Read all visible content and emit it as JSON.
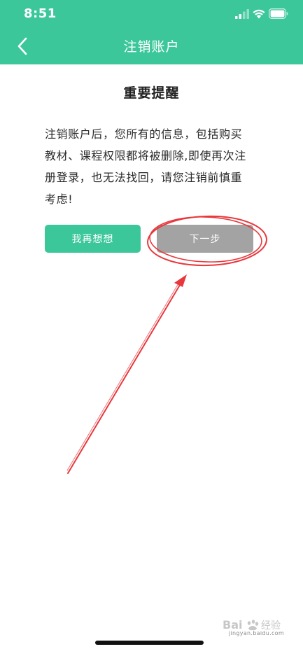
{
  "status_bar": {
    "time": "8:51",
    "icons": [
      "signal-icon",
      "wifi-icon",
      "battery-icon"
    ]
  },
  "nav": {
    "title": "注销账户",
    "back_icon": "chevron-left-icon"
  },
  "content": {
    "title": "重要提醒",
    "warning_lines": [
      "注销账户后，您所有的信息，包括购买",
      "教材、课程权限都将被删除,即使再次注",
      "册登录，也无法找回，请您注销前慎重",
      "考虑!"
    ]
  },
  "buttons": {
    "rethink_label": "我再想想",
    "next_label": "下一步"
  },
  "watermark": {
    "text": "jingyan.baidu.com"
  },
  "colors": {
    "brand_green": "#3cc79a",
    "disabled_gray": "#a3a3a3",
    "annotation_red": "#e8383d"
  }
}
